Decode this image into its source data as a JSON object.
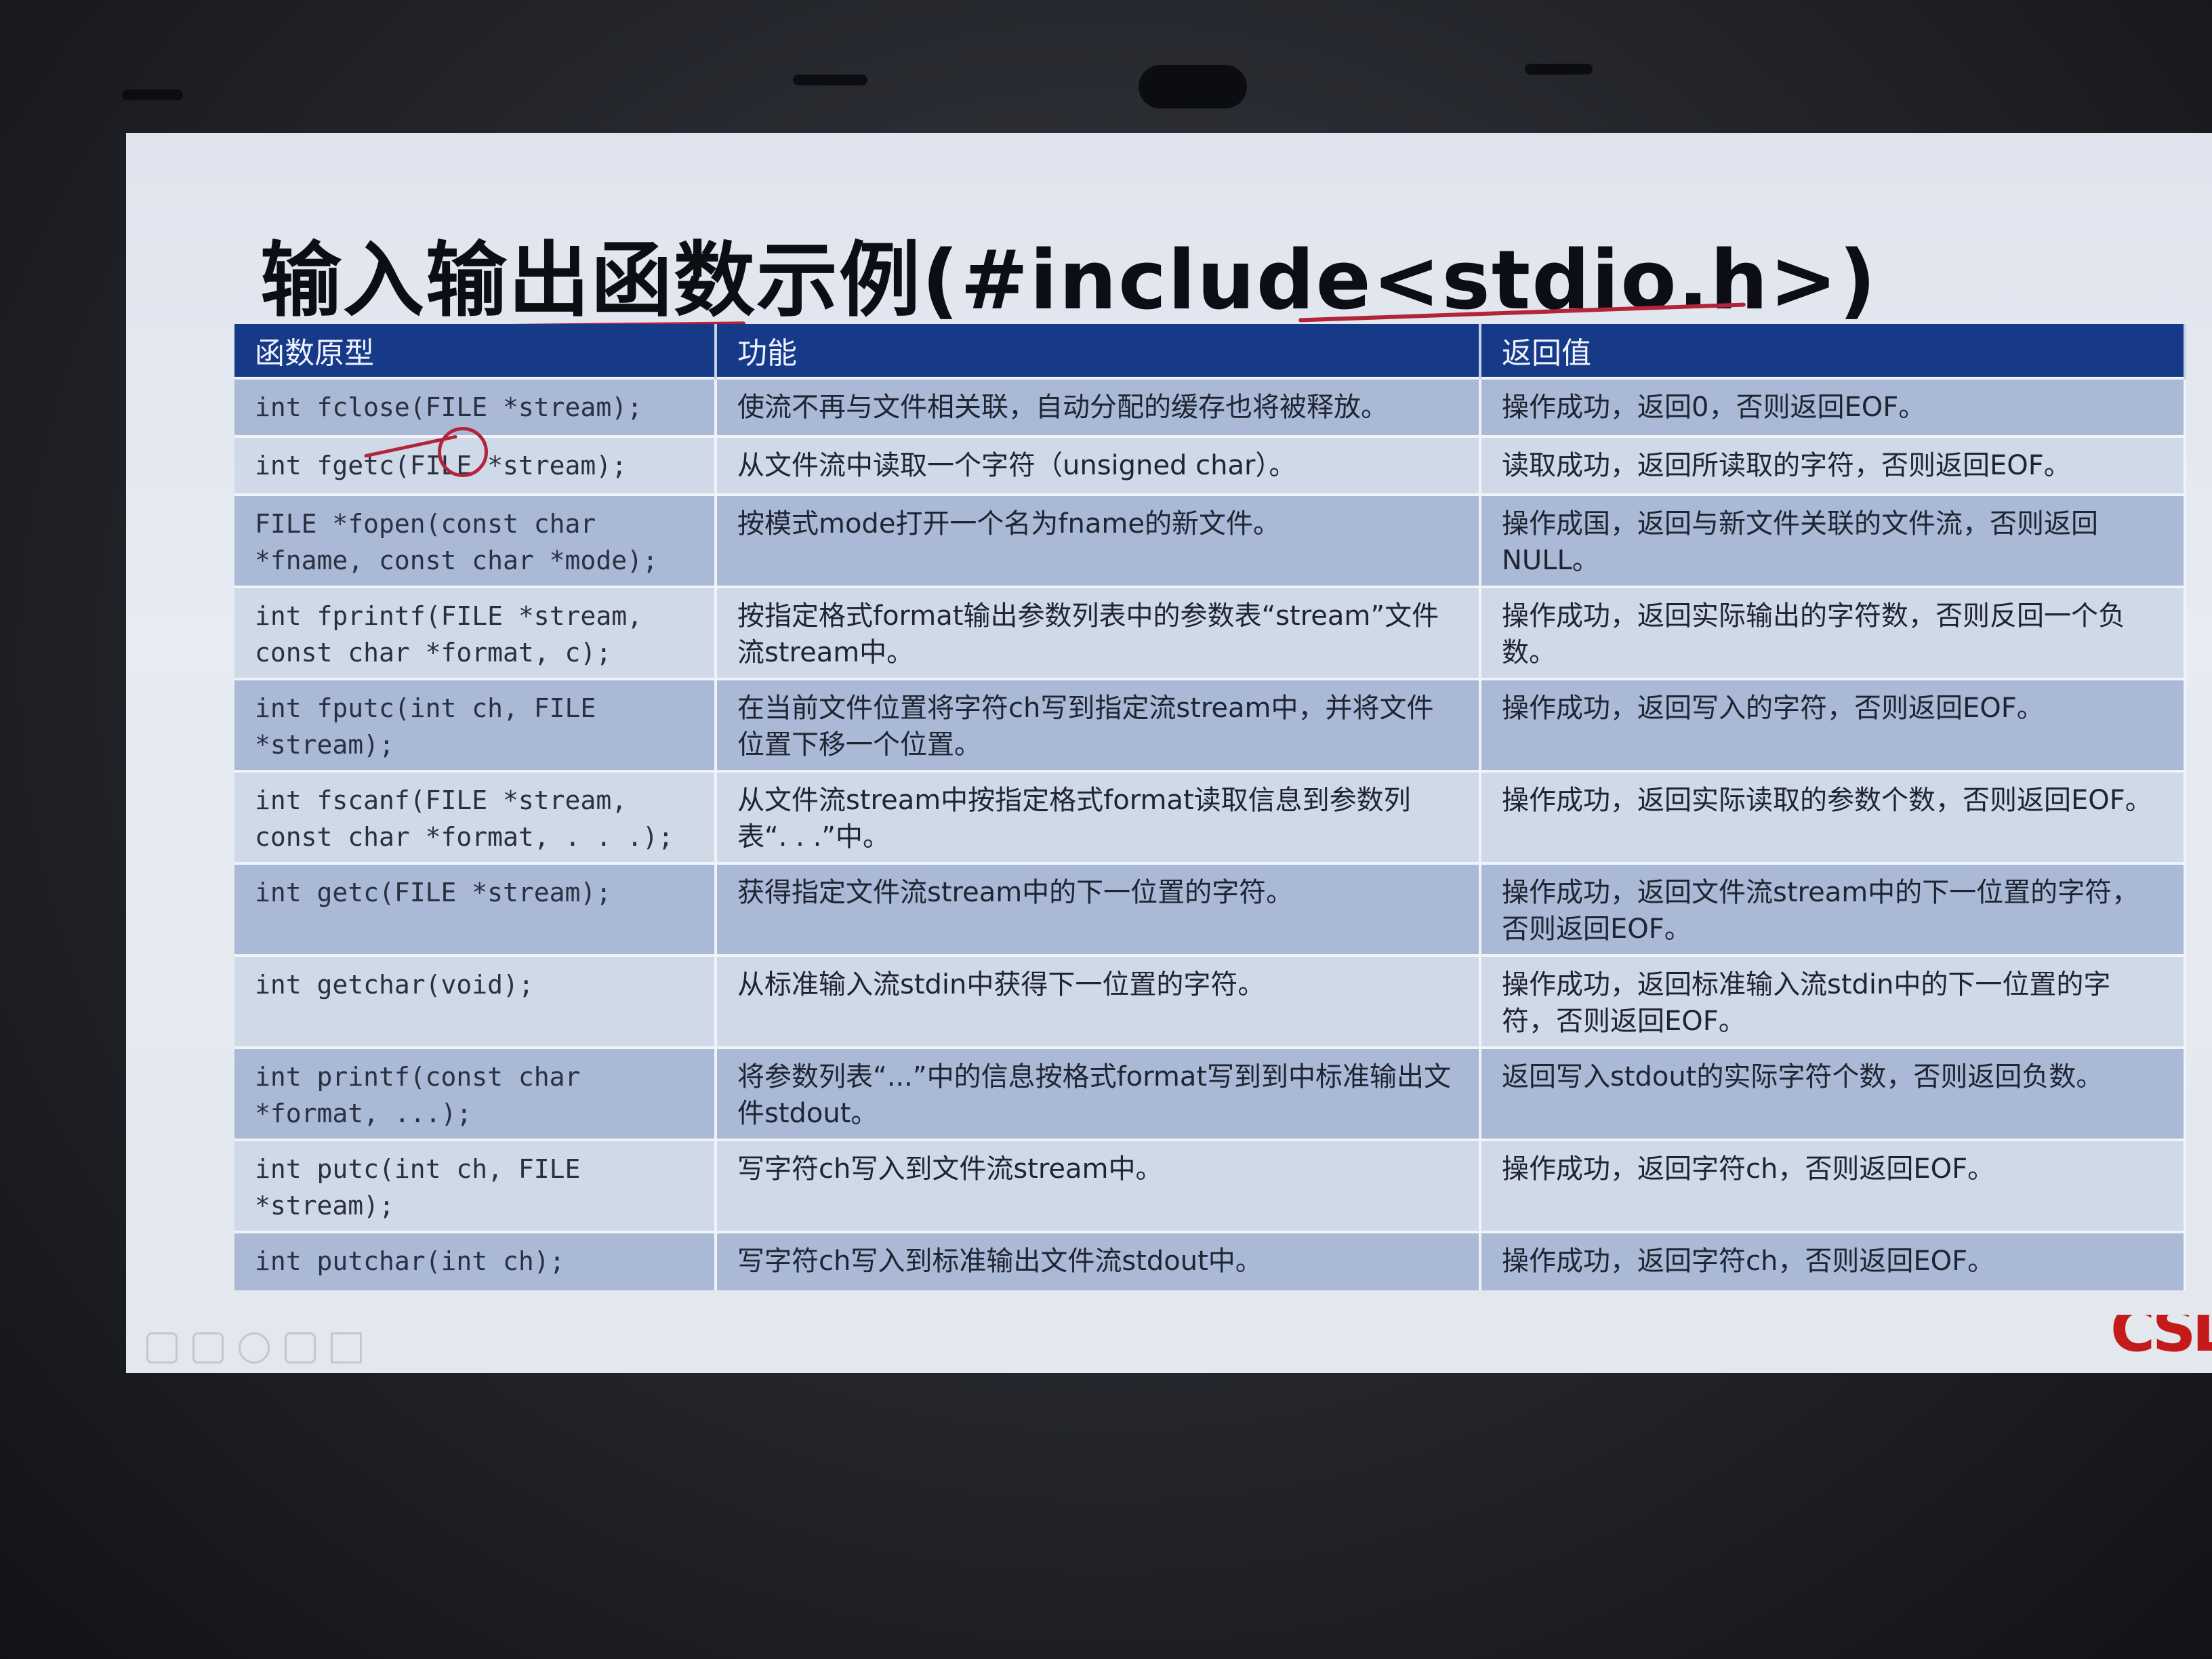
{
  "slide": {
    "title": "输入输出函数示例(#include<stdio.h>)"
  },
  "table": {
    "headers": [
      "函数原型",
      "功能",
      "返回值"
    ],
    "rows": [
      {
        "proto": "int fclose(FILE *stream);",
        "desc": "使流不再与文件相关联，自动分配的缓存也将被释放。",
        "ret": "操作成功，返回0，否则返回EOF。"
      },
      {
        "proto": "int fgetc(FILE *stream);",
        "desc": "从文件流中读取一个字符（unsigned char）。",
        "ret": "读取成功，返回所读取的字符，否则返回EOF。"
      },
      {
        "proto": "FILE *fopen(const char *fname, const char *mode);",
        "desc": "按模式mode打开一个名为fname的新文件。",
        "ret": "操作成国，返回与新文件关联的文件流，否则返回NULL。"
      },
      {
        "proto": "int fprintf(FILE *stream, const char *format, c);",
        "desc": "按指定格式format输出参数列表中的参数表“stream”文件流stream中。",
        "ret": "操作成功，返回实际输出的字符数，否则反回一个负数。"
      },
      {
        "proto": "int fputc(int ch, FILE *stream);",
        "desc": "在当前文件位置将字符ch写到指定流stream中，并将文件位置下移一个位置。",
        "ret": "操作成功，返回写入的字符，否则返回EOF。"
      },
      {
        "proto": "int fscanf(FILE *stream, const char *format, . . .);",
        "desc": "从文件流stream中按指定格式format读取信息到参数列表“. . .”中。",
        "ret": "操作成功，返回实际读取的参数个数，否则返回EOF。"
      },
      {
        "proto": "int getc(FILE *stream);",
        "desc": "获得指定文件流stream中的下一位置的字符。",
        "ret": "操作成功，返回文件流stream中的下一位置的字符，否则返回EOF。"
      },
      {
        "proto": "int getchar(void);",
        "desc": "从标准输入流stdin中获得下一位置的字符。",
        "ret": "操作成功，返回标准输入流stdin中的下一位置的字符，否则返回EOF。"
      },
      {
        "proto": "int printf(const char *format, ...);",
        "desc": "将参数列表“...”中的信息按格式format写到到中标准输出文件stdout。",
        "ret": "返回写入stdout的实际字符个数，否则返回负数。"
      },
      {
        "proto": "int putc(int ch, FILE *stream);",
        "desc": "写字符ch写入到文件流stream中。",
        "ret": "操作成功，返回字符ch，否则返回EOF。"
      },
      {
        "proto": "int putchar(int ch);",
        "desc": "写字符ch写入到标准输出文件流stdout中。",
        "ret": "操作成功，返回字符ch，否则返回EOF。"
      }
    ]
  },
  "logo": {
    "fragment_text": "CSD",
    "color": "#c41a1a"
  },
  "colors": {
    "header_bg": "#173a88",
    "row_dark": "#a9b9d6",
    "row_light": "#d0d9e8",
    "annotation": "#b3243a"
  },
  "icons": [
    "pen-icon",
    "rectangle-icon",
    "circle-icon",
    "eraser-icon",
    "pointer-icon"
  ]
}
